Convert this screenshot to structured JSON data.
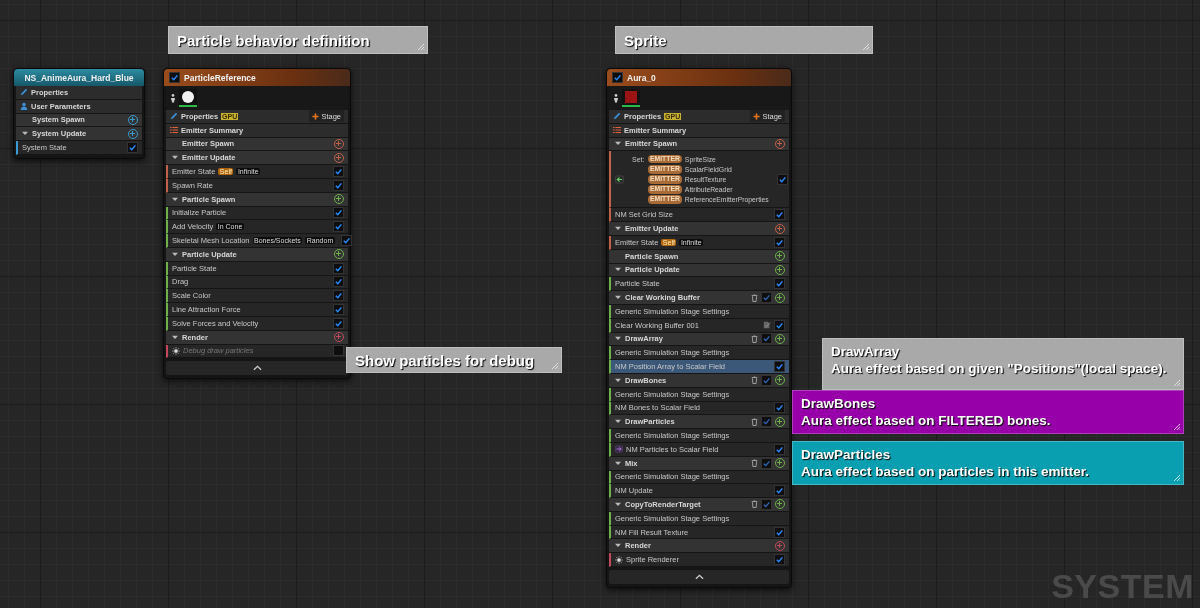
{
  "graph_label": "SYSTEM",
  "comments": [
    {
      "title": "Particle behavior definition",
      "color": "#a9a9a9"
    },
    {
      "title": "Sprite",
      "color": "#a9a9a9"
    },
    {
      "title": "Show particles for debug",
      "color": "#a9a9a9"
    },
    {
      "title": "DrawArray",
      "text": "Aura effect based on given \"Positions\"(local space).",
      "color": "#a9a9a9"
    },
    {
      "title": "DrawBones",
      "text": "Aura effect based on FILTERED bones.",
      "color": "#9700a8"
    },
    {
      "title": "DrawParticles",
      "text": "Aura effect based on particles in this emitter.",
      "color": "#0a9fb0"
    }
  ],
  "nodes": [
    {
      "kind": "system",
      "title": "NS_AnimeAura_Hard_Blue",
      "rows": [
        {
          "kind": "properties",
          "label": "Properties"
        },
        {
          "kind": "user",
          "label": "User Parameters"
        },
        {
          "kind": "section",
          "label": "System Spawn",
          "expanded": false,
          "color": "#3b9ad2"
        },
        {
          "kind": "section",
          "label": "System Update",
          "expanded": true,
          "color": "#3b9ad2"
        },
        {
          "kind": "module",
          "label": "System State",
          "checked": true,
          "selected": false
        }
      ]
    },
    {
      "kind": "emitter",
      "title": "ParticleReference",
      "enabled": true,
      "rows": [
        {
          "kind": "thumbnails",
          "color": "#f2f2f2"
        },
        {
          "kind": "properties",
          "label": "Properties",
          "badge": "GPU",
          "button": "Stage"
        },
        {
          "kind": "summary",
          "label": "Emitter Summary"
        },
        {
          "kind": "section",
          "label": "Emitter Spawn",
          "expanded": false,
          "color": "#c0614a"
        },
        {
          "kind": "section",
          "label": "Emitter Update",
          "expanded": true,
          "color": "#c0614a"
        },
        {
          "kind": "module",
          "label": "Emitter State",
          "tags": [
            {
              "text": "Self",
              "kind": "highlight"
            },
            {
              "text": "Infinite",
              "kind": "plain"
            }
          ],
          "checked": true,
          "selected": false
        },
        {
          "kind": "module",
          "label": "Spawn Rate",
          "checked": true,
          "selected": false
        },
        {
          "kind": "section",
          "label": "Particle Spawn",
          "expanded": true,
          "color": "#6db04c"
        },
        {
          "kind": "module",
          "label": "Initialize Particle",
          "checked": true,
          "selected": false
        },
        {
          "kind": "module",
          "label": "Add Velocity",
          "tags": [
            {
              "text": "In Cone",
              "kind": "plain"
            }
          ],
          "checked": true,
          "selected": false
        },
        {
          "kind": "module",
          "label": "Skeletal Mesh Location",
          "tags": [
            {
              "text": "Bones/Sockets",
              "kind": "plain"
            },
            {
              "text": "Random",
              "kind": "plain"
            }
          ],
          "checked": true,
          "selected": false
        },
        {
          "kind": "section",
          "label": "Particle Update",
          "expanded": true,
          "color": "#6db04c"
        },
        {
          "kind": "module",
          "label": "Particle State",
          "checked": true,
          "selected": false
        },
        {
          "kind": "module",
          "label": "Drag",
          "checked": true,
          "selected": false
        },
        {
          "kind": "module",
          "label": "Scale Color",
          "checked": true,
          "selected": false
        },
        {
          "kind": "module",
          "label": "Line Attraction Force",
          "checked": true,
          "selected": false
        },
        {
          "kind": "module",
          "label": "Solve Forces and Velocity",
          "checked": true,
          "selected": false
        },
        {
          "kind": "section",
          "label": "Render",
          "expanded": true,
          "color": "#c04a5c"
        },
        {
          "kind": "renderer",
          "label": "Debug draw particles",
          "checked": false,
          "selected": false
        }
      ]
    },
    {
      "kind": "emitter",
      "title": "Aura_0",
      "enabled": true,
      "rows": [
        {
          "kind": "thumbnails",
          "color": "#9a1414"
        },
        {
          "kind": "properties",
          "label": "Properties",
          "badge": "GPU",
          "button": "Stage"
        },
        {
          "kind": "summary",
          "label": "Emitter Summary"
        },
        {
          "kind": "section",
          "label": "Emitter Spawn",
          "expanded": true,
          "color": "#c0614a"
        },
        {
          "kind": "set",
          "label": "Set:",
          "params": [
            {
              "tag": "EMITTER",
              "name": "SpriteSize"
            },
            {
              "tag": "EMITTER",
              "name": "ScalarFieldGrid"
            },
            {
              "tag": "EMITTER",
              "name": "ResultTexture"
            },
            {
              "tag": "EMITTER",
              "name": "AttributeReader"
            },
            {
              "tag": "EMITTER",
              "name": "ReferenceEmitterProperties"
            }
          ],
          "checked": true,
          "selected": false
        },
        {
          "kind": "module",
          "label": "NM Set Grid Size",
          "checked": true,
          "selected": false
        },
        {
          "kind": "section",
          "label": "Emitter Update",
          "expanded": true,
          "color": "#c0614a"
        },
        {
          "kind": "module",
          "label": "Emitter State",
          "tags": [
            {
              "text": "Self",
              "kind": "highlight"
            },
            {
              "text": "Infinite",
              "kind": "plain"
            }
          ],
          "checked": true,
          "selected": false
        },
        {
          "kind": "section",
          "label": "Particle Spawn",
          "expanded": false,
          "color": "#6db04c"
        },
        {
          "kind": "section",
          "label": "Particle Update",
          "expanded": true,
          "color": "#6db04c"
        },
        {
          "kind": "module",
          "label": "Particle State",
          "checked": true,
          "selected": false
        },
        {
          "kind": "stage",
          "label": "Clear Working Buffer",
          "expanded": true,
          "checked": true,
          "color": "#6db04c"
        },
        {
          "kind": "module",
          "label": "Generic Simulation Stage Settings",
          "selected": false
        },
        {
          "kind": "scratch",
          "label": "Clear Working Buffer 001",
          "checked": true,
          "selected": false
        },
        {
          "kind": "stage",
          "label": "DrawArray",
          "expanded": true,
          "checked": true,
          "color": "#6db04c"
        },
        {
          "kind": "module",
          "label": "Generic Simulation Stage Settings",
          "selected": false
        },
        {
          "kind": "module",
          "label": "NM Position Array to Scalar Field",
          "checked": true,
          "selected": true
        },
        {
          "kind": "stage",
          "label": "DrawBones",
          "expanded": true,
          "checked": true,
          "color": "#6db04c"
        },
        {
          "kind": "module",
          "label": "Generic Simulation Stage Settings",
          "selected": false
        },
        {
          "kind": "module",
          "label": "NM Bones to Scalar Field",
          "checked": true,
          "selected": false
        },
        {
          "kind": "stage",
          "label": "DrawParticles",
          "expanded": true,
          "checked": true,
          "color": "#6db04c"
        },
        {
          "kind": "module",
          "label": "Generic Simulation Stage Settings",
          "selected": false
        },
        {
          "kind": "input",
          "label": "NM Particles to Scalar Field",
          "checked": true,
          "selected": false
        },
        {
          "kind": "stage",
          "label": "Mix",
          "expanded": true,
          "checked": true,
          "color": "#6db04c"
        },
        {
          "kind": "module",
          "label": "Generic Simulation Stage Settings",
          "selected": false
        },
        {
          "kind": "module",
          "label": "NM Update",
          "checked": true,
          "selected": false
        },
        {
          "kind": "stage",
          "label": "CopyToRenderTarget",
          "expanded": true,
          "checked": true,
          "color": "#6db04c"
        },
        {
          "kind": "module",
          "label": "Generic Simulation Stage Settings",
          "selected": false
        },
        {
          "kind": "module",
          "label": "NM Fill Result Texture",
          "checked": true,
          "selected": false
        },
        {
          "kind": "section",
          "label": "Render",
          "expanded": true,
          "color": "#c04a5c"
        },
        {
          "kind": "renderer",
          "label": "Sprite Renderer",
          "checked": true,
          "selected": false
        }
      ]
    }
  ]
}
